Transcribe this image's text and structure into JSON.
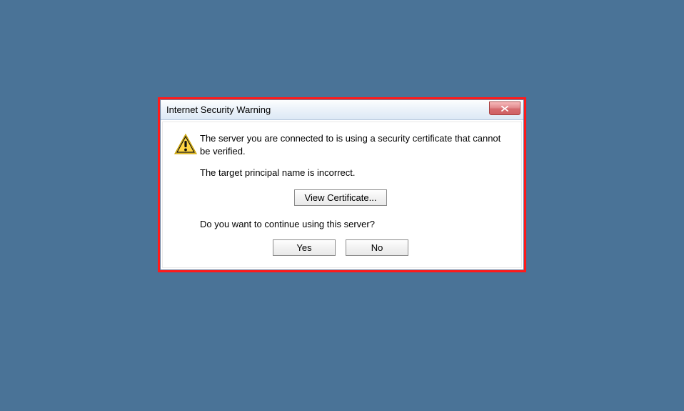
{
  "dialog": {
    "title": "Internet Security Warning",
    "message1": "The server you are connected to is using a security certificate that cannot be verified.",
    "message2": "The target principal name is incorrect.",
    "view_cert_label": "View Certificate...",
    "message3": "Do you want to continue using this server?",
    "yes_label": "Yes",
    "no_label": "No"
  }
}
